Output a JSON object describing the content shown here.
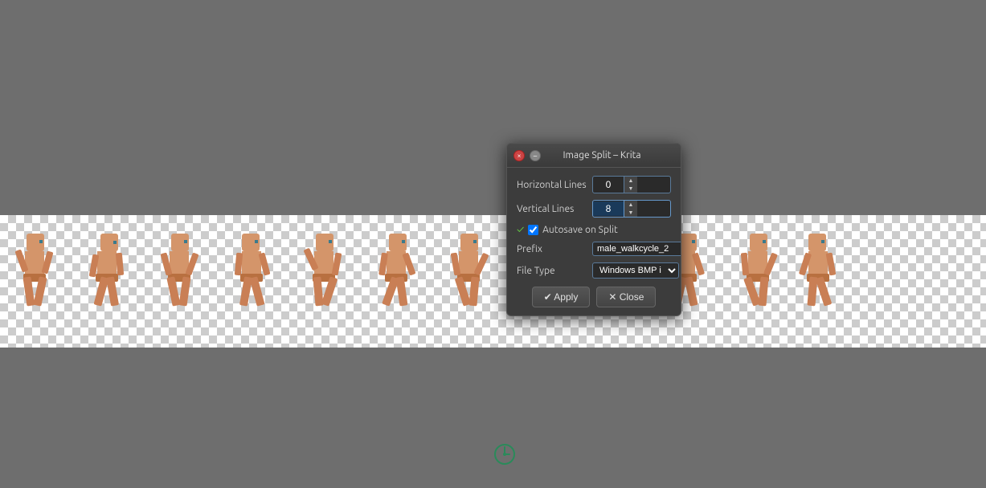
{
  "app": {
    "title": "Image Split – Krita",
    "background_color": "#6e6e6e"
  },
  "dialog": {
    "title": "Image Split – Krita",
    "horizontal_lines_label": "Horizontal Lines",
    "horizontal_lines_value": "0",
    "vertical_lines_label": "Vertical Lines",
    "vertical_lines_value": "8",
    "autosave_label": "Autosave on Split",
    "autosave_checked": true,
    "prefix_label": "Prefix",
    "prefix_value": "male_walkcycle_2",
    "filetype_label": "File Type",
    "filetype_value": "Windows BMP i",
    "apply_button": "✔ Apply",
    "close_button": "✕ Close"
  },
  "titlebar": {
    "close_title": "×",
    "minimize_title": "–"
  },
  "clock_cursor": {
    "label": "loading cursor"
  }
}
